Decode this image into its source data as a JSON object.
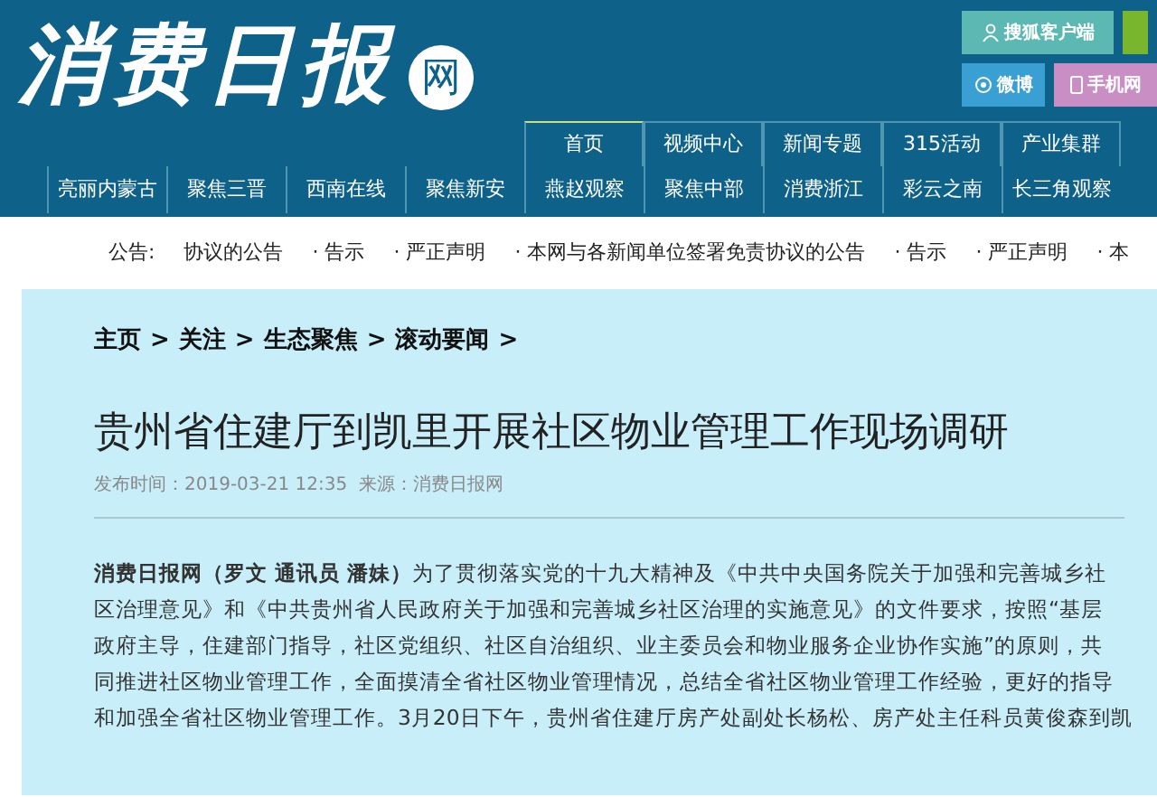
{
  "header": {
    "logo": "消费日报",
    "logo_badge": "网",
    "buttons": [
      {
        "label": "搜狐客户端",
        "kind": "client",
        "color": "#5cb8b2"
      },
      {
        "label": "微博",
        "kind": "weibo",
        "color": "#3a9fd2"
      },
      {
        "label": "手机网",
        "kind": "phone",
        "color": "#c98fc4"
      }
    ]
  },
  "nav_primary": [
    {
      "label": "首页",
      "selected": true
    },
    {
      "label": "视频中心",
      "selected": false
    },
    {
      "label": "新闻专题",
      "selected": false
    },
    {
      "label": "315活动",
      "selected": false
    },
    {
      "label": "产业集群",
      "selected": false
    }
  ],
  "nav_regional": [
    "亮丽内蒙古",
    "聚焦三晋",
    "西南在线",
    "聚焦新安",
    "燕赵观察",
    "聚焦中部",
    "消费浙江",
    "彩云之南",
    "长三角观察"
  ],
  "notice": {
    "label": "公告:",
    "items": [
      "协议的公告",
      "· 告示",
      "· 严正声明",
      "· 本网与各新闻单位签署免责协议的公告",
      "· 告示",
      "· 严正声明",
      "· 本"
    ]
  },
  "article": {
    "breadcrumb": [
      "主页",
      "关注",
      "生态聚焦",
      "滚动要闻"
    ],
    "breadcrumb_separator": ">",
    "title": "贵州省住建厅到凯里开展社区物业管理工作现场调研",
    "meta": "发布时间：2019-03-21 12:35  来源：消费日报网",
    "lines": [
      "**消费日报网（罗文 通讯员 潘妹）**为了贯彻落实党的十九大精神及《中共中央国务院关于加强和完善城乡社",
      "区治理意见》和《中共贵州省人民政府关于加强和完善城乡社区治理的实施意见》的文件要求，按照“基层",
      "政府主导，住建部门指导，社区党组织、社区自治组织、业主委员会和物业服务企业协作实施”的原则，共",
      "同推进社区物业管理工作，全面摸清全省社区物业管理情况，总结全省社区物业管理工作经验，更好的指导",
      "和加强全省社区物业管理工作。3月20日下午，贵州省住建厅房产处副处长杨松、房产处主任科员黄俊森到凯"
    ]
  }
}
